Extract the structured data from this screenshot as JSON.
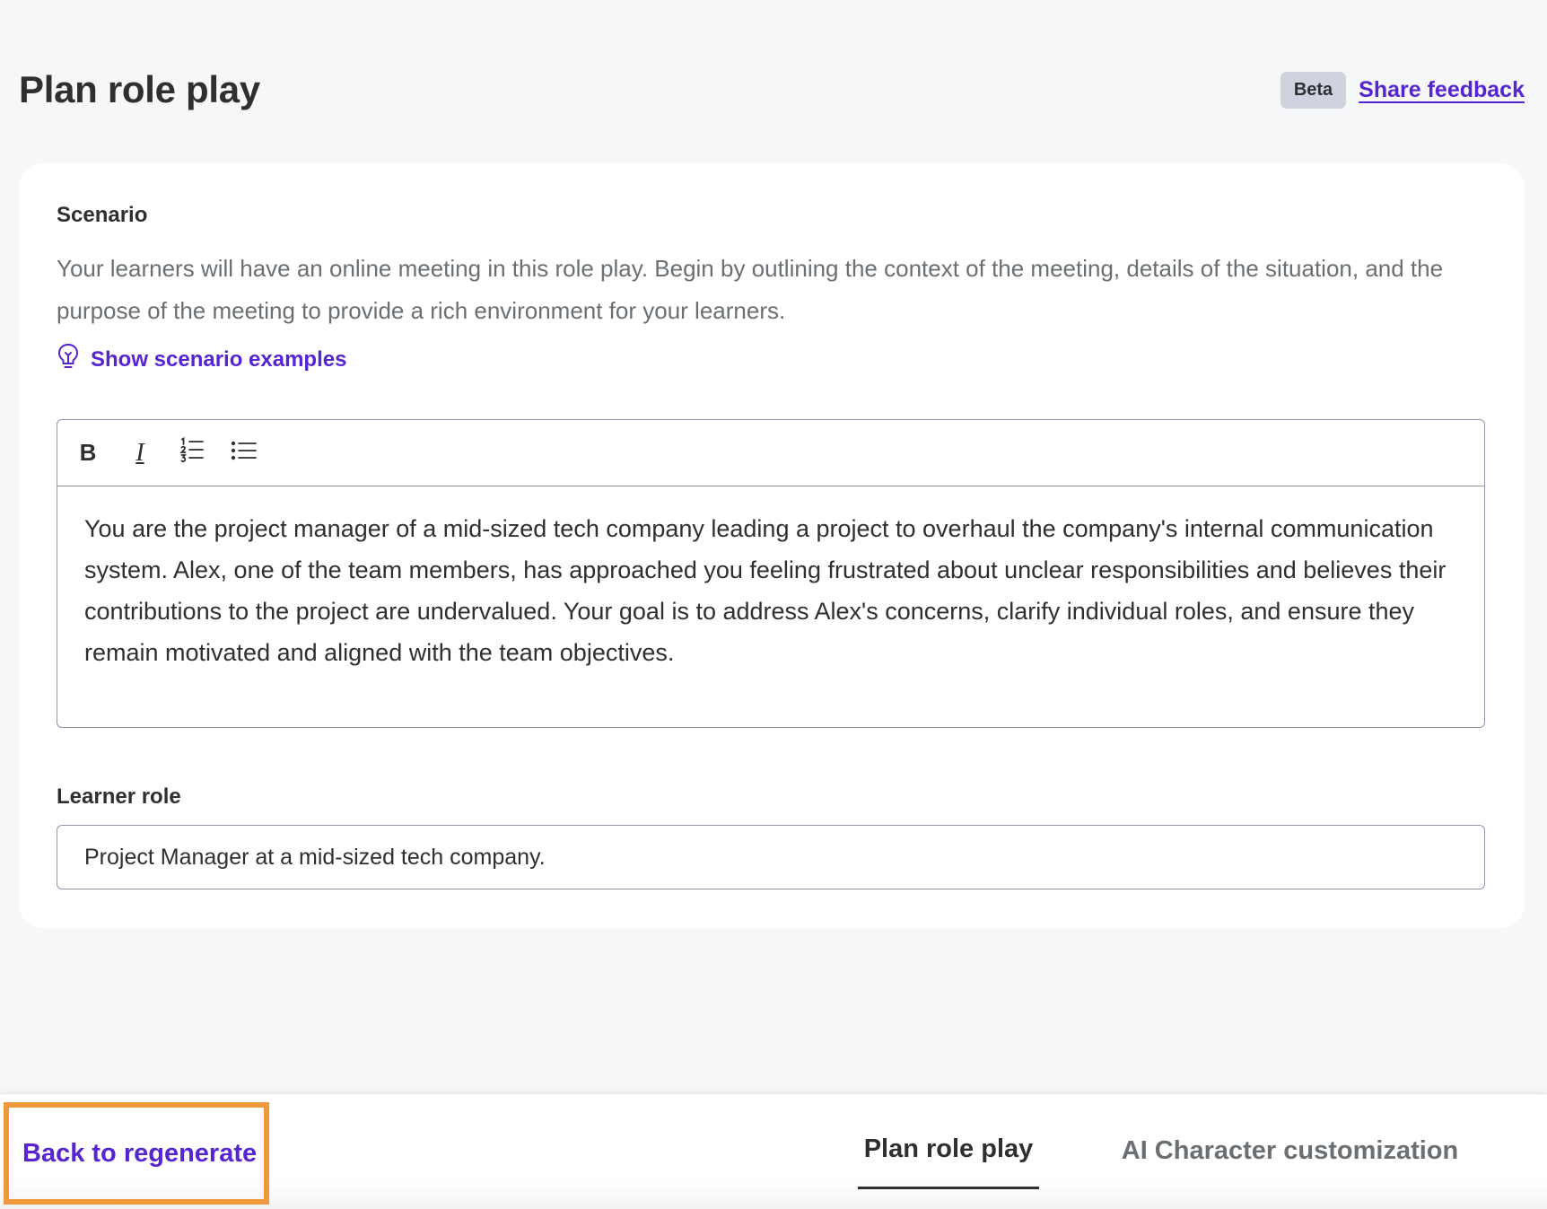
{
  "header": {
    "title": "Plan role play",
    "badge": "Beta",
    "feedback_link": "Share feedback"
  },
  "scenario": {
    "label": "Scenario",
    "description": "Your learners will have an online meeting in this role play. Begin by outlining the context of the meeting, details of the situation, and the purpose of the meeting to provide a rich environment for your learners.",
    "examples_link": "Show scenario examples",
    "examples_icon": "lightbulb-icon",
    "toolbar": {
      "bold": "B",
      "italic": "I",
      "ordered_list_icon": "ordered-list-icon",
      "bullet_list_icon": "bullet-list-icon"
    },
    "text": "You are the project manager of a mid-sized tech company leading a project to overhaul the company's internal communication system. Alex, one of the team members, has approached you feeling frustrated about unclear responsibilities and believes their contributions to the project are undervalued. Your goal is to address Alex's concerns, clarify individual roles, and ensure they remain motivated and aligned with the team objectives."
  },
  "learner_role": {
    "label": "Learner role",
    "value": "Project Manager at a mid-sized tech company."
  },
  "footer": {
    "back_link": "Back to regenerate",
    "steps": [
      {
        "label": "Plan role play",
        "active": true
      },
      {
        "label": "AI Character customization",
        "active": false
      }
    ]
  },
  "colors": {
    "accent": "#5624d0",
    "text": "#2d2f31",
    "muted": "#6a6f73",
    "highlight": "#f0993a"
  }
}
